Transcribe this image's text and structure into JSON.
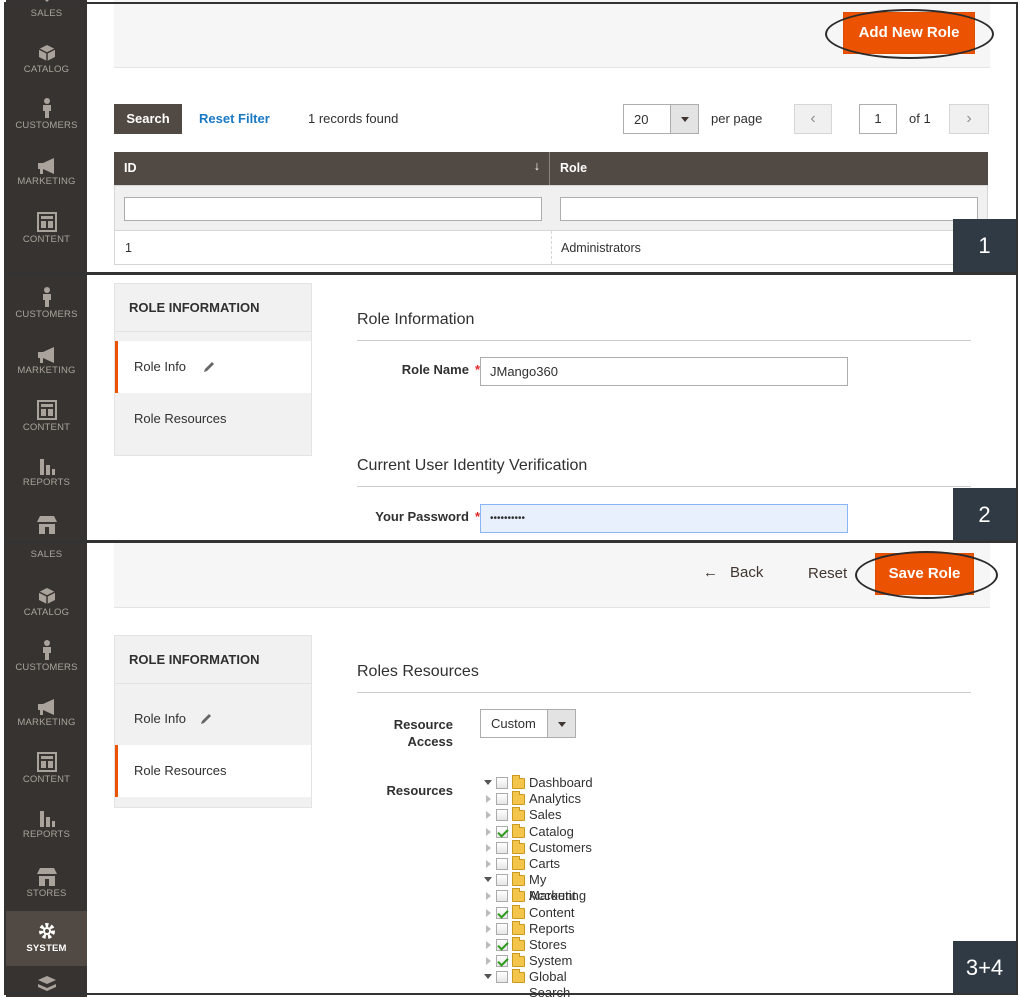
{
  "nav": {
    "sales": "SALES",
    "catalog": "CATALOG",
    "customers": "CUSTOMERS",
    "marketing": "MARKETING",
    "content": "CONTENT",
    "reports": "REPORTS",
    "stores": "STORES",
    "system": "SYSTEM"
  },
  "panel1": {
    "add_new_role": "Add New Role",
    "search": "Search",
    "reset_filter": "Reset Filter",
    "records_found": "1 records found",
    "per_page_value": "20",
    "per_page_label": "per page",
    "page_value": "1",
    "of_pages": "of 1",
    "prev_icon": "‹",
    "next_icon": "›",
    "columns": {
      "id": "ID",
      "role": "Role"
    },
    "sort_icon": "↓",
    "rows": [
      {
        "id": "1",
        "role": "Administrators"
      }
    ],
    "step": "1"
  },
  "panel2": {
    "tabs_title": "ROLE INFORMATION",
    "tab_role_info": "Role Info",
    "tab_role_resources": "Role Resources",
    "section_role_info": "Role Information",
    "role_name_label": "Role Name",
    "role_name_value": "JMango360",
    "section_verification": "Current User Identity Verification",
    "password_label": "Your Password",
    "password_value": "••••••••••",
    "step": "2"
  },
  "panel3": {
    "back": "Back",
    "reset": "Reset",
    "save_role": "Save Role",
    "tabs_title": "ROLE INFORMATION",
    "tab_role_info": "Role Info",
    "tab_role_resources": "Role Resources",
    "section_title": "Roles Resources",
    "resource_access_label_1": "Resource",
    "resource_access_label_2": "Access",
    "resource_access_value": "Custom",
    "resources_label": "Resources",
    "tree": [
      {
        "label": "Dashboard",
        "toggle": "expanded",
        "checked": false
      },
      {
        "label": "Analytics",
        "toggle": "collapsed",
        "checked": false
      },
      {
        "label": "Sales",
        "toggle": "collapsed",
        "checked": false
      },
      {
        "label": "Catalog",
        "toggle": "collapsed",
        "checked": true
      },
      {
        "label": "Customers",
        "toggle": "collapsed",
        "checked": false
      },
      {
        "label": "Carts",
        "toggle": "collapsed",
        "checked": false
      },
      {
        "label": "My Account",
        "toggle": "expanded",
        "checked": false
      },
      {
        "label": "Marketing",
        "toggle": "collapsed",
        "checked": false
      },
      {
        "label": "Content",
        "toggle": "collapsed",
        "checked": true
      },
      {
        "label": "Reports",
        "toggle": "collapsed",
        "checked": false
      },
      {
        "label": "Stores",
        "toggle": "collapsed",
        "checked": true
      },
      {
        "label": "System",
        "toggle": "collapsed",
        "checked": true
      },
      {
        "label": "Global Search",
        "toggle": "expanded",
        "checked": false
      }
    ],
    "step": "3+4"
  }
}
